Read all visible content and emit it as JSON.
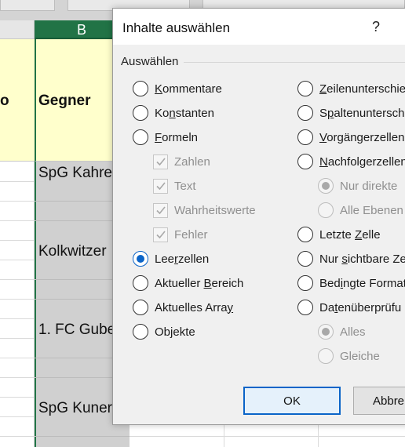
{
  "sheet": {
    "column_b_letter": "B",
    "header_partial_left": "o",
    "header_gegner": "Gegner",
    "cells": [
      "SpG Kahre",
      "Kolkwitzer",
      "1. FC Gube",
      "SpG Kuner"
    ],
    "accent_color": "#217346",
    "header_fill": "#ffffcc"
  },
  "dialog": {
    "title": "Inhalte auswählen",
    "help": "?",
    "group_label": "Auswählen",
    "left_options": [
      {
        "pre": "",
        "key": "K",
        "post": "ommentare",
        "checked": false
      },
      {
        "pre": "Ko",
        "key": "n",
        "post": "stanten",
        "checked": false
      },
      {
        "pre": "",
        "key": "F",
        "post": "ormeln",
        "checked": false
      }
    ],
    "formula_subs": [
      {
        "label": "Zahlen",
        "checked": true
      },
      {
        "label": "Text",
        "checked": true
      },
      {
        "label": "Wahrheitswerte",
        "checked": true
      },
      {
        "label": "Fehler",
        "checked": true
      }
    ],
    "left_options_2": [
      {
        "pre": "Lee",
        "key": "r",
        "post": "zellen",
        "checked": true
      },
      {
        "pre": "Aktueller ",
        "key": "B",
        "post": "ereich",
        "checked": false
      },
      {
        "pre": "Aktuelles Arra",
        "key": "y",
        "post": "",
        "checked": false
      },
      {
        "pre": "Ob",
        "key": "j",
        "post": "ekte",
        "checked": false
      }
    ],
    "right_options": [
      {
        "pre": "",
        "key": "Z",
        "post": "eilenunterschie",
        "checked": false
      },
      {
        "pre": "S",
        "key": "p",
        "post": "altenunterschi",
        "checked": false
      },
      {
        "pre": "",
        "key": "V",
        "post": "orgängerzellen",
        "checked": false
      },
      {
        "pre": "",
        "key": "N",
        "post": "achfolgerzellen",
        "checked": false
      }
    ],
    "right_subs_1": [
      {
        "label": "Nur direkte",
        "checked": true
      },
      {
        "label": "Alle Ebenen",
        "checked": false
      }
    ],
    "right_options_2": [
      {
        "pre": "Letzte ",
        "key": "Z",
        "post": "elle",
        "checked": false
      },
      {
        "pre": "Nur ",
        "key": "s",
        "post": "ichtbare Ze",
        "checked": false
      },
      {
        "pre": "Bed",
        "key": "i",
        "post": "ngte Format",
        "checked": false
      },
      {
        "pre": "Da",
        "key": "t",
        "post": "enüberprüfu",
        "checked": false
      }
    ],
    "right_subs_2": [
      {
        "label": "Alles",
        "checked": true
      },
      {
        "label": "Gleiche",
        "checked": false
      }
    ],
    "ok_label": "OK",
    "cancel_label": "Abbre",
    "accent_color": "#0a64c8"
  }
}
